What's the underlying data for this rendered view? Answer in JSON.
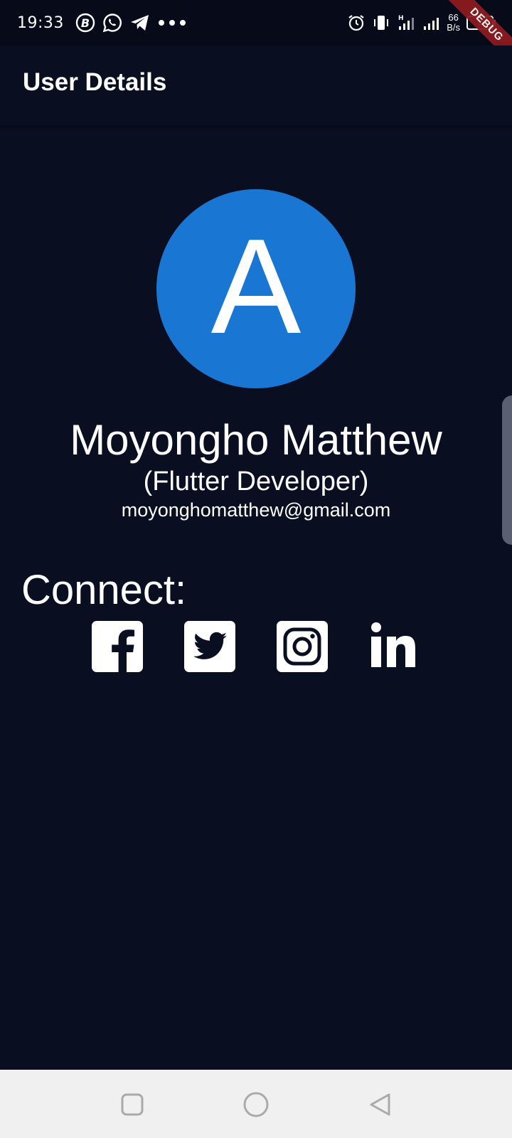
{
  "status_bar": {
    "time": "19:33",
    "left_icons": [
      "bitcoin-icon",
      "whatsapp-icon",
      "telegram-icon",
      "more-dots-icon"
    ],
    "right_icons": [
      "alarm-icon",
      "vibrate-icon",
      "signal-h-icon",
      "signal-icon"
    ],
    "net_speed_value": "66",
    "net_speed_unit": "B/s",
    "battery": "3"
  },
  "debug_banner": "DEBUG",
  "app_bar": {
    "title": "User Details"
  },
  "profile": {
    "initial": "A",
    "avatar_color": "#1976d2",
    "name": "Moyongho Matthew",
    "role": "(Flutter Developer)",
    "email": "moyonghomatthew@gmail.com"
  },
  "connect": {
    "label": "Connect:",
    "links": [
      "facebook-icon",
      "twitter-icon",
      "instagram-icon",
      "linkedin-icon"
    ]
  },
  "colors": {
    "background": "#0a0e21",
    "nav_bar": "#f0f0f0",
    "debug": "#8b1a1f"
  }
}
